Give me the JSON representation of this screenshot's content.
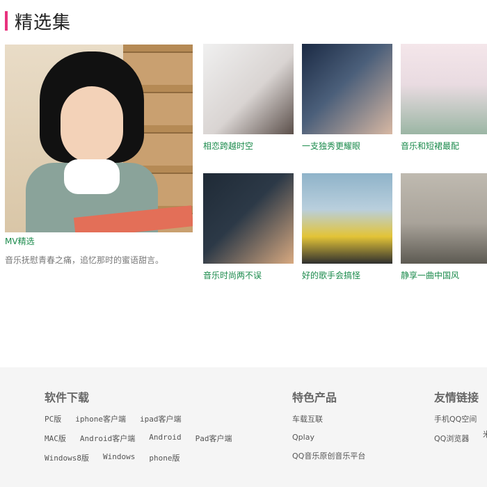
{
  "section": {
    "title": "精选集"
  },
  "feature": {
    "label": "MV精选",
    "desc": "音乐抚慰青春之痛，追忆那时的蜜语甜言。"
  },
  "thumbs": [
    {
      "label": "相恋跨越时空",
      "colors": [
        "#f0f0f0",
        "#5b4f4a"
      ]
    },
    {
      "label": "一支独秀更耀眼",
      "colors": [
        "#1b2a44",
        "#d8b8a3"
      ]
    },
    {
      "label": "音乐和短裙最配",
      "colors": [
        "#f4e6ea",
        "#9bb6a4"
      ]
    },
    {
      "label": "音乐时尚两不误",
      "colors": [
        "#1f2a36",
        "#d8a980"
      ]
    },
    {
      "label": "好的歌手会搞怪",
      "colors": [
        "#8fb3c9",
        "#e3c437"
      ]
    },
    {
      "label": "静享一曲中国风",
      "colors": [
        "#bfbab0",
        "#5d5a52"
      ]
    }
  ],
  "footer": {
    "software": {
      "title": "软件下载",
      "rows": [
        [
          "PC版",
          "iphone客户端",
          "ipad客户端"
        ],
        [
          "MAC版",
          "Android客户端",
          "Android",
          "Pad客户端"
        ],
        [
          "Windows8版",
          "Windows",
          "phone版"
        ]
      ]
    },
    "products": {
      "title": "特色产品",
      "items": [
        "车载互联",
        "Qplay",
        "QQ音乐原创音乐平台"
      ]
    },
    "links": {
      "title": "友情链接",
      "items": [
        "手机QQ空间",
        "QQ浏览器"
      ],
      "extra": "米"
    }
  },
  "colors": {
    "accent": "#e8327e",
    "link_green": "#1a8a4b"
  }
}
